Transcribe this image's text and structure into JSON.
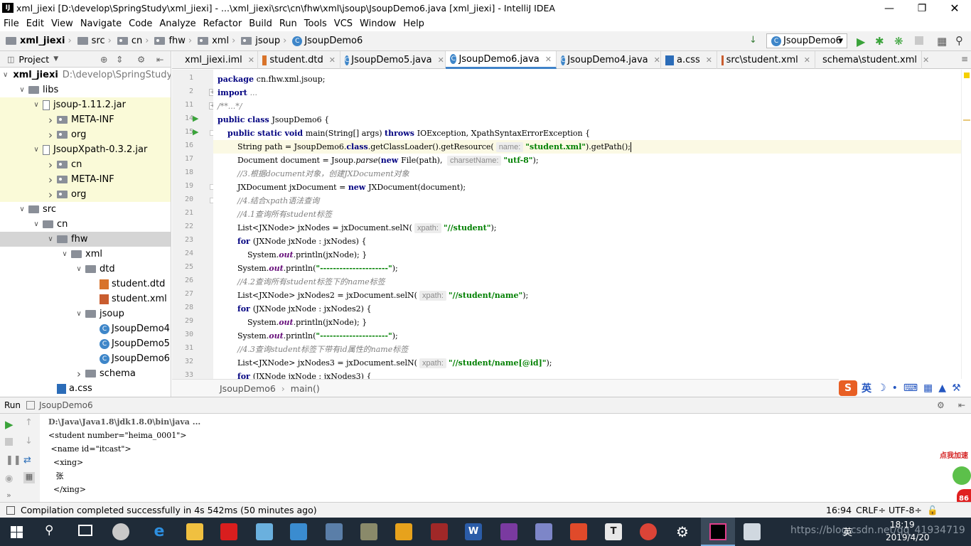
{
  "window": {
    "title": "xml_jiexi [D:\\develop\\SpringStudy\\xml_jiexi] - ...\\xml_jiexi\\src\\cn\\fhw\\xml\\jsoup\\JsoupDemo6.java [xml_jiexi] - IntelliJ IDEA",
    "logo": "IJ"
  },
  "menu": [
    "File",
    "Edit",
    "View",
    "Navigate",
    "Code",
    "Analyze",
    "Refactor",
    "Build",
    "Run",
    "Tools",
    "VCS",
    "Window",
    "Help"
  ],
  "breadcrumb": [
    "xml_jiexi",
    "src",
    "cn",
    "fhw",
    "xml",
    "jsoup",
    "JsoupDemo6"
  ],
  "run_config": "JsoupDemo6",
  "project_panel": {
    "title": "Project"
  },
  "tree": [
    {
      "label": "xml_jiexi",
      "extra": "D:\\develop\\SpringStudy",
      "arrow": "v",
      "icon": "module",
      "depth": 0,
      "style": ""
    },
    {
      "label": "libs",
      "arrow": "v",
      "icon": "folder",
      "depth": 1,
      "style": ""
    },
    {
      "label": "jsoup-1.11.2.jar",
      "arrow": "v",
      "icon": "jar",
      "depth": 2,
      "style": "y"
    },
    {
      "label": "META-INF",
      "arrow": ">",
      "icon": "pkg",
      "depth": 3,
      "style": "y"
    },
    {
      "label": "org",
      "arrow": ">",
      "icon": "pkg",
      "depth": 3,
      "style": "y"
    },
    {
      "label": "JsoupXpath-0.3.2.jar",
      "arrow": "v",
      "icon": "jar",
      "depth": 2,
      "style": "y"
    },
    {
      "label": "cn",
      "arrow": ">",
      "icon": "pkg",
      "depth": 3,
      "style": "y"
    },
    {
      "label": "META-INF",
      "arrow": ">",
      "icon": "pkg",
      "depth": 3,
      "style": "y"
    },
    {
      "label": "org",
      "arrow": ">",
      "icon": "pkg",
      "depth": 3,
      "style": "y"
    },
    {
      "label": "src",
      "arrow": "v",
      "icon": "folder",
      "depth": 1,
      "style": ""
    },
    {
      "label": "cn",
      "arrow": "v",
      "icon": "folder",
      "depth": 2,
      "style": ""
    },
    {
      "label": "fhw",
      "arrow": "v",
      "icon": "folder",
      "depth": 3,
      "style": "sel"
    },
    {
      "label": "xml",
      "arrow": "v",
      "icon": "folder",
      "depth": 4,
      "style": ""
    },
    {
      "label": "dtd",
      "arrow": "v",
      "icon": "folder",
      "depth": 5,
      "style": ""
    },
    {
      "label": "student.dtd",
      "arrow": "",
      "icon": "dtd",
      "depth": 6,
      "style": ""
    },
    {
      "label": "student.xml",
      "arrow": "",
      "icon": "xml",
      "depth": 6,
      "style": ""
    },
    {
      "label": "jsoup",
      "arrow": "v",
      "icon": "folder",
      "depth": 5,
      "style": ""
    },
    {
      "label": "JsoupDemo4",
      "arrow": "",
      "icon": "class",
      "depth": 6,
      "style": ""
    },
    {
      "label": "JsoupDemo5",
      "arrow": "",
      "icon": "class",
      "depth": 6,
      "style": ""
    },
    {
      "label": "JsoupDemo6",
      "arrow": "",
      "icon": "class",
      "depth": 6,
      "style": ""
    },
    {
      "label": "schema",
      "arrow": ">",
      "icon": "folder",
      "depth": 5,
      "style": ""
    },
    {
      "label": "a.css",
      "arrow": "",
      "icon": "css",
      "depth": 3,
      "style": ""
    }
  ],
  "tabs": [
    {
      "label": "xml_jiexi.iml",
      "icon": "iml"
    },
    {
      "label": "student.dtd",
      "icon": "dtd"
    },
    {
      "label": "JsoupDemo5.java",
      "icon": "class"
    },
    {
      "label": "JsoupDemo6.java",
      "icon": "class",
      "active": true
    },
    {
      "label": "JsoupDemo4.java",
      "icon": "class"
    },
    {
      "label": "a.css",
      "icon": "css"
    },
    {
      "label": "src\\student.xml",
      "icon": "xml"
    },
    {
      "label": "schema\\student.xml",
      "icon": "xml"
    }
  ],
  "line_numbers": [
    "1",
    "2",
    "11",
    "14",
    "15",
    "16",
    "17",
    "18",
    "19",
    "20",
    "21",
    "22",
    "23",
    "24",
    "25",
    "26",
    "27",
    "28",
    "29",
    "30",
    "31",
    "32",
    "33"
  ],
  "code_lines": [
    [
      [
        "kw",
        "package "
      ],
      [
        "",
        "cn.fhw.xml.jsoup;"
      ]
    ],
    [
      [
        "kw",
        "import "
      ],
      [
        "cm",
        "..."
      ]
    ],
    [
      [
        "cm",
        "/**...*/"
      ]
    ],
    [
      [
        "kw",
        "public class "
      ],
      [
        "",
        "JsoupDemo6 {"
      ]
    ],
    [
      [
        "",
        "    "
      ],
      [
        "kw",
        "public static void "
      ],
      [
        "",
        "main(String[] args) "
      ],
      [
        "kw",
        "throws "
      ],
      [
        "",
        "IOException, XpathSyntaxErrorException {"
      ]
    ],
    [
      [
        "",
        "        String path = JsoupDemo6."
      ],
      [
        "kw",
        "class"
      ],
      [
        "",
        ".getClassLoader().getResource("
      ],
      [
        "hint",
        "name:"
      ],
      [
        "st",
        "\"student.xml\""
      ],
      [
        "",
        ").getPath();"
      ]
    ],
    [
      [
        "",
        "        Document document = Jsoup."
      ],
      [
        "it",
        "parse"
      ],
      [
        "",
        "("
      ],
      [
        "kw",
        "new "
      ],
      [
        "",
        "File(path), "
      ],
      [
        "hint",
        "charsetName:"
      ],
      [
        "st",
        "\"utf-8\""
      ],
      [
        "",
        ");"
      ]
    ],
    [
      [
        "",
        "        "
      ],
      [
        "cm",
        "//3.根据document对象，创建JXDocument对象"
      ]
    ],
    [
      [
        "",
        "        JXDocument jxDocument = "
      ],
      [
        "kw",
        "new "
      ],
      [
        "",
        "JXDocument(document);"
      ]
    ],
    [
      [
        "",
        "        "
      ],
      [
        "cm",
        "//4.结合xpath语法查询"
      ]
    ],
    [
      [
        "",
        "        "
      ],
      [
        "cm",
        "//4.1查询所有student标签"
      ]
    ],
    [
      [
        "",
        "        List<JXNode> jxNodes = jxDocument.selN("
      ],
      [
        "hint",
        "xpath:"
      ],
      [
        "st",
        "\"//student\""
      ],
      [
        "",
        ");"
      ]
    ],
    [
      [
        "",
        "        "
      ],
      [
        "kw",
        "for "
      ],
      [
        "",
        "(JXNode jxNode : jxNodes) {"
      ]
    ],
    [
      [
        "",
        "            System."
      ],
      [
        "fld",
        "out"
      ],
      [
        "",
        ".println(jxNode); }"
      ]
    ],
    [
      [
        "",
        "        System."
      ],
      [
        "fld",
        "out"
      ],
      [
        "",
        ".println("
      ],
      [
        "st",
        "\"---------------------\""
      ],
      [
        "",
        ");"
      ]
    ],
    [
      [
        "",
        "        "
      ],
      [
        "cm",
        "//4.2查询所有student标签下的name标签"
      ]
    ],
    [
      [
        "",
        "        List<JXNode> jxNodes2 = jxDocument.selN("
      ],
      [
        "hint",
        "xpath:"
      ],
      [
        "st",
        "\"//student/name\""
      ],
      [
        "",
        ");"
      ]
    ],
    [
      [
        "",
        "        "
      ],
      [
        "kw",
        "for "
      ],
      [
        "",
        "(JXNode jxNode : jxNodes2) {"
      ]
    ],
    [
      [
        "",
        "            System."
      ],
      [
        "fld",
        "out"
      ],
      [
        "",
        ".println(jxNode); }"
      ]
    ],
    [
      [
        "",
        "        System."
      ],
      [
        "fld",
        "out"
      ],
      [
        "",
        ".println("
      ],
      [
        "st",
        "\"---------------------\""
      ],
      [
        "",
        ");"
      ]
    ],
    [
      [
        "",
        "        "
      ],
      [
        "cm",
        "//4.3查询student标签下带有id属性的name标签"
      ]
    ],
    [
      [
        "",
        "        List<JXNode> jxNodes3 = jxDocument.selN("
      ],
      [
        "hint",
        "xpath:"
      ],
      [
        "st",
        "\"//student/name[@id]\""
      ],
      [
        "",
        ");"
      ]
    ],
    [
      [
        "",
        "        "
      ],
      [
        "kw",
        "for "
      ],
      [
        "",
        "(JXNode jxNode : jxNodes3) {"
      ]
    ]
  ],
  "editor_crumb": [
    "JsoupDemo6",
    "main()"
  ],
  "run_panel": {
    "label": "Run",
    "config": "JsoupDemo6"
  },
  "console": [
    "D:\\Java\\Java1.8\\jdk1.8.0\\bin\\java ...",
    "<student number=\"heima_0001\">",
    " <name id=\"itcast\">",
    "  <xing>",
    "   张",
    "  </xing>"
  ],
  "status": {
    "message": "Compilation completed successfully in 4s 542ms (50 minutes ago)",
    "position": "16:94",
    "line_sep": "CRLF÷",
    "encoding": "UTF-8÷"
  },
  "ime": {
    "lang": "英"
  },
  "floating_badge": {
    "label": "点我加速",
    "value": "86"
  },
  "taskbar": {
    "time": "18:19",
    "date": "2019/4/20",
    "ime": "英",
    "watermark": "https://blog.csdn.net/qq_41934719"
  }
}
